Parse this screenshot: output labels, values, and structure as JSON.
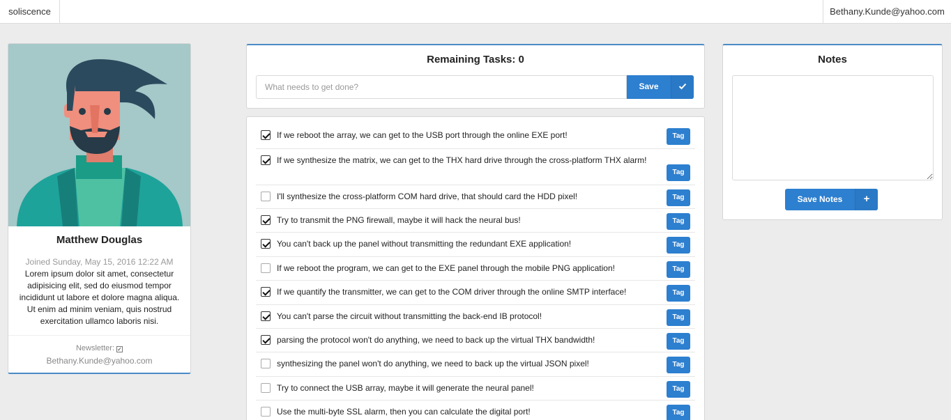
{
  "nav": {
    "brand": "soliscence",
    "user_email": "Bethany.Kunde@yahoo.com"
  },
  "profile": {
    "name": "Matthew Douglas",
    "joined": "Joined Sunday, May 15, 2016 12:22 AM",
    "bio": "Lorem ipsum dolor sit amet, consectetur adipisicing elit, sed do eiusmod tempor incididunt ut labore et dolore magna aliqua. Ut enim ad minim veniam, quis nostrud exercitation ullamco laboris nisi.",
    "newsletter_label": "Newsletter:",
    "newsletter_checked": true,
    "email": "Bethany.Kunde@yahoo.com",
    "avatar_colors": {
      "background": "#a5c8c8",
      "hair": "#2c4a5e",
      "skin": "#f08f7e",
      "sweater": "#1ea39a"
    }
  },
  "tasks_header": {
    "title": "Remaining Tasks: 0",
    "input_placeholder": "What needs to get done?",
    "input_value": "",
    "save_label": "Save",
    "save_icon": "check-icon"
  },
  "tasks": [
    {
      "text": "If we reboot the array, we can get to the USB port through the online EXE port!",
      "done": true,
      "tag_label": "Tag"
    },
    {
      "text": "If we synthesize the matrix, we can get to the THX hard drive through the cross-platform THX alarm!",
      "done": true,
      "tag_label": "Tag"
    },
    {
      "text": "I'll synthesize the cross-platform COM hard drive, that should card the HDD pixel!",
      "done": false,
      "tag_label": "Tag"
    },
    {
      "text": "Try to transmit the PNG firewall, maybe it will hack the neural bus!",
      "done": true,
      "tag_label": "Tag"
    },
    {
      "text": "You can't back up the panel without transmitting the redundant EXE application!",
      "done": true,
      "tag_label": "Tag"
    },
    {
      "text": "If we reboot the program, we can get to the EXE panel through the mobile PNG application!",
      "done": false,
      "tag_label": "Tag"
    },
    {
      "text": "If we quantify the transmitter, we can get to the COM driver through the online SMTP interface!",
      "done": true,
      "tag_label": "Tag"
    },
    {
      "text": "You can't parse the circuit without transmitting the back-end IB protocol!",
      "done": true,
      "tag_label": "Tag"
    },
    {
      "text": "parsing the protocol won't do anything, we need to back up the virtual THX bandwidth!",
      "done": true,
      "tag_label": "Tag"
    },
    {
      "text": "synthesizing the panel won't do anything, we need to back up the virtual JSON pixel!",
      "done": false,
      "tag_label": "Tag"
    },
    {
      "text": "Try to connect the USB array, maybe it will generate the neural panel!",
      "done": false,
      "tag_label": "Tag"
    },
    {
      "text": "Use the multi-byte SSL alarm, then you can calculate the digital port!",
      "done": false,
      "tag_label": "Tag"
    }
  ],
  "notes": {
    "title": "Notes",
    "value": "",
    "save_label": "Save Notes",
    "save_icon": "plus-icon"
  },
  "colors": {
    "accent": "#2d7fcf",
    "page_bg": "#ececec",
    "card_border_accent": "#4a8ac4"
  }
}
